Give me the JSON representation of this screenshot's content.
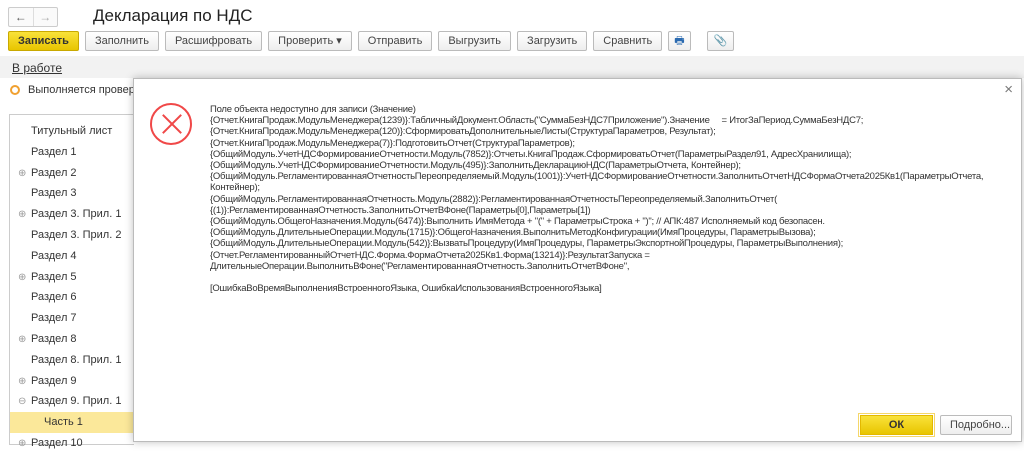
{
  "window": {
    "title": "Декларация по НДС"
  },
  "toolbar": {
    "save": "Записать",
    "fill": "Заполнить",
    "decode": "Расшифровать",
    "check": "Проверить",
    "send": "Отправить",
    "export": "Выгрузить",
    "import": "Загрузить",
    "compare": "Сравнить"
  },
  "status": {
    "link": "В работе",
    "progress": "Выполняется проверка."
  },
  "tree": [
    {
      "label": "Титульный лист",
      "expander": ""
    },
    {
      "label": "Раздел 1",
      "expander": ""
    },
    {
      "label": "Раздел 2",
      "expander": "⊕"
    },
    {
      "label": "Раздел 3",
      "expander": ""
    },
    {
      "label": "Раздел 3. Прил. 1",
      "expander": "⊕"
    },
    {
      "label": "Раздел 3. Прил. 2",
      "expander": ""
    },
    {
      "label": "Раздел 4",
      "expander": ""
    },
    {
      "label": "Раздел 5",
      "expander": "⊕"
    },
    {
      "label": "Раздел 6",
      "expander": ""
    },
    {
      "label": "Раздел 7",
      "expander": ""
    },
    {
      "label": "Раздел 8",
      "expander": "⊕"
    },
    {
      "label": "Раздел 8. Прил. 1",
      "expander": ""
    },
    {
      "label": "Раздел 9",
      "expander": "⊕"
    },
    {
      "label": "Раздел 9. Прил. 1",
      "expander": "⊖"
    },
    {
      "label": "Часть 1",
      "expander": "",
      "selected": true,
      "sub": true
    },
    {
      "label": "Раздел 10",
      "expander": "⊕"
    }
  ],
  "dialog": {
    "message": "Поле объекта недоступно для записи (Значение)\n{Отчет.КнигаПродаж.МодульМенеджера(1239)}:ТабличныйДокумент.Область(\"СуммаБезНДС7Приложение\").Значение     = ИтогЗаПериод.СуммаБезНДС7;\n{Отчет.КнигаПродаж.МодульМенеджера(120)}:СформироватьДополнительныеЛисты(СтруктураПараметров, Результат);\n{Отчет.КнигаПродаж.МодульМенеджера(7)}:ПодготовитьОтчет(СтруктураПараметров);\n{ОбщийМодуль.УчетНДСФормированиеОтчетности.Модуль(7852)}:Отчеты.КнигаПродаж.СформироватьОтчет(ПараметрыРаздел91, АдресХранилища);\n{ОбщийМодуль.УчетНДСФормированиеОтчетности.Модуль(495)}:ЗаполнитьДекларациюНДС(ПараметрыОтчета, Контейнер);\n{ОбщийМодуль.РегламентированнаяОтчетностьПереопределяемый.Модуль(1001)}:УчетНДСФормированиеОтчетности.ЗаполнитьОтчетНДСФормаОтчета2025Кв1(ПараметрыОтчета,\nКонтейнер);\n{ОбщийМодуль.РегламентированнаяОтчетность.Модуль(2882)}:РегламентированнаяОтчетностьПереопределяемый.ЗаполнитьОтчет(\n{(1)}:РегламентированнаяОтчетность.ЗаполнитьОтчетВФоне(Параметры[0],Параметры[1])\n{ОбщийМодуль.ОбщегоНазначения.Модуль(6474)}:Выполнить ИмяМетода + \"(\" + ПараметрыСтрока + \")\"; // АПК:487 Исполняемый код безопасен.\n{ОбщийМодуль.ДлительныеОперации.Модуль(1715)}:ОбщегоНазначения.ВыполнитьМетодКонфигурации(ИмяПроцедуры, ПараметрыВызова);\n{ОбщийМодуль.ДлительныеОперации.Модуль(542)}:ВызватьПроцедуру(ИмяПроцедуры, ПараметрыЭкспортнойПроцедуры, ПараметрыВыполнения);\n{Отчет.РегламентированныйОтчетНДС.Форма.ФормаОтчета2025Кв1.Форма(13214)}:РезультатЗапуска =\nДлительныеОперации.ВыполнитьВФоне(\"РегламентированнаяОтчетность.ЗаполнитьОтчетВФоне\",\n\n[ОшибкаВоВремяВыполненияВстроенногоЯзыка, ОшибкаИспользованияВстроенногоЯзыка]",
    "ok": "ОК",
    "details": "Подробно..."
  }
}
